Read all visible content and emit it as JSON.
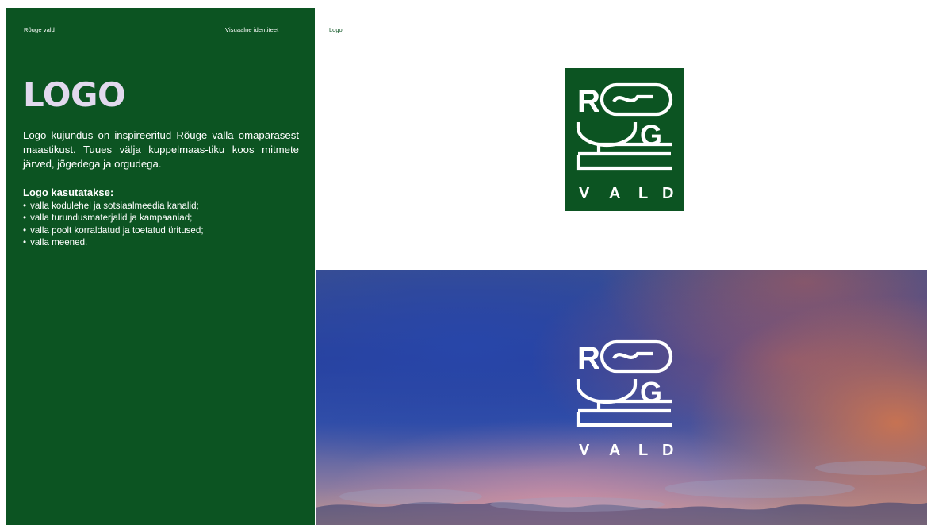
{
  "header": {
    "org_name": "Rõuge vald",
    "section_name": "Visuaalne identiteet"
  },
  "left_panel": {
    "title": "LOGO",
    "intro": "Logo kujundus on inspireeritud Rõuge valla omapärasest maastikust. Tuues välja kuppelmaas-tiku koos mitmete järved, jõgedega ja orgudega.",
    "usage_heading": "Logo kasutatakse:",
    "usage_items": [
      "valla kodulehel ja sotsiaalmeedia kanalid;",
      "valla turundusmaterjalid ja kampaaniad;",
      "valla poolt korraldatud ja toetatud üritused;",
      "valla meened."
    ]
  },
  "right_panel": {
    "label": "Logo",
    "logo_letters": {
      "r": "R",
      "g": "G",
      "vald": [
        "V",
        "A",
        "L",
        "D"
      ]
    }
  },
  "colors": {
    "brand_green": "#0c5422",
    "title_lilac": "#e2d9ee",
    "white": "#ffffff"
  }
}
